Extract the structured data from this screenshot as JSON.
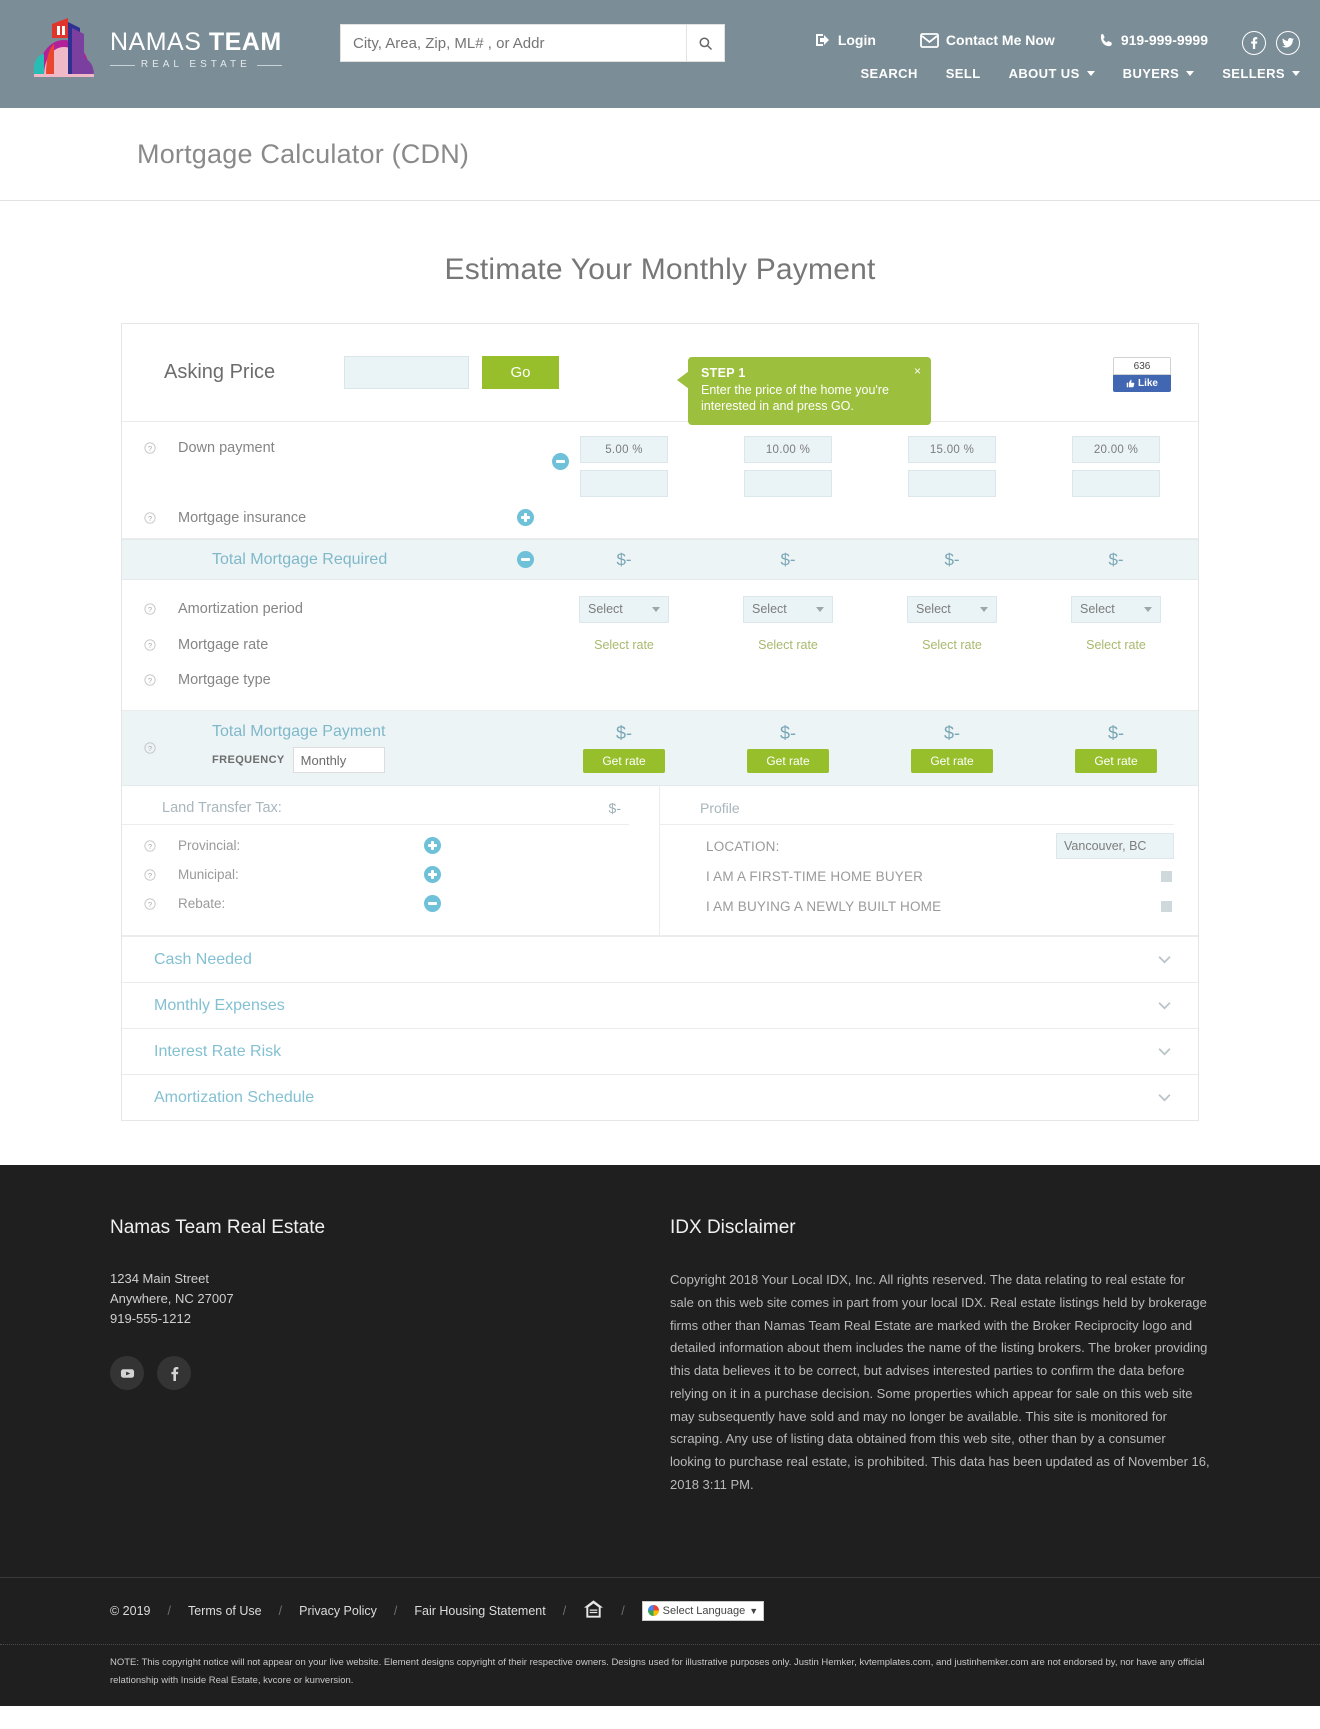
{
  "header": {
    "logo": {
      "line1_light": "NAMAS",
      "line1_bold": "TEAM",
      "line2": "REAL ESTATE"
    },
    "search_placeholder": "City, Area, Zip, ML# , or Addr",
    "search_value": "",
    "login_label": "Login",
    "contact_label": "Contact Me Now",
    "phone": "919-999-9999",
    "nav": [
      {
        "label": "SEARCH",
        "has_caret": false
      },
      {
        "label": "SELL",
        "has_caret": false
      },
      {
        "label": "ABOUT US",
        "has_caret": true
      },
      {
        "label": "BUYERS",
        "has_caret": true
      },
      {
        "label": "SELLERS",
        "has_caret": true
      }
    ]
  },
  "page_title": "Mortgage Calculator (CDN)",
  "calculator": {
    "heading": "Estimate Your Monthly Payment",
    "asking_price_label": "Asking Price",
    "asking_price_value": "",
    "go_label": "Go",
    "tooltip": {
      "step": "STEP 1",
      "body": "Enter the price of the home you're interested in and press GO.",
      "close": "×"
    },
    "facebook": {
      "count": "636",
      "like": "Like"
    },
    "down_payment_label": "Down payment",
    "mortgage_insurance_label": "Mortgage insurance",
    "down_payment_percents": [
      "5.00 %",
      "10.00 %",
      "15.00 %",
      "20.00 %"
    ],
    "down_payment_amounts": [
      "",
      "",
      "",
      ""
    ],
    "total_required_label": "Total Mortgage Required",
    "total_required_values": [
      "$-",
      "$-",
      "$-",
      "$-"
    ],
    "amortization_label": "Amortization period",
    "amortization_values": [
      "Select",
      "Select",
      "Select",
      "Select"
    ],
    "mortgage_rate_label": "Mortgage rate",
    "mortgage_rate_values": [
      "Select rate",
      "Select rate",
      "Select rate",
      "Select rate"
    ],
    "mortgage_type_label": "Mortgage type",
    "total_payment_label": "Total Mortgage Payment",
    "total_payment_values": [
      "$-",
      "$-",
      "$-",
      "$-"
    ],
    "frequency_label": "FREQUENCY",
    "frequency_value": "Monthly",
    "get_rate_label": "Get rate",
    "land_transfer": {
      "title": "Land Transfer Tax:",
      "value": "$-",
      "rows": [
        {
          "label": "Provincial:",
          "ctrl": "plus"
        },
        {
          "label": "Municipal:",
          "ctrl": "plus"
        },
        {
          "label": "Rebate:",
          "ctrl": "minus"
        }
      ]
    },
    "profile": {
      "title": "Profile",
      "location_label": "LOCATION:",
      "location_value": "Vancouver, BC",
      "checks": [
        {
          "label": "I AM A FIRST-TIME HOME BUYER"
        },
        {
          "label": "I AM BUYING A NEWLY BUILT HOME"
        }
      ]
    },
    "accordions": [
      {
        "label": "Cash Needed"
      },
      {
        "label": "Monthly Expenses"
      },
      {
        "label": "Interest Rate Risk"
      },
      {
        "label": "Amortization Schedule"
      }
    ]
  },
  "footer": {
    "company_heading": "Namas Team Real Estate",
    "address_line1": "1234 Main Street",
    "address_line2": "Anywhere, NC 27007",
    "phone": "919-555-1212",
    "idx_heading": "IDX Disclaimer",
    "idx_text": "Copyright 2018 Your Local IDX, Inc. All rights reserved. The data relating to real estate for sale on this web site comes in part from your local IDX. Real estate listings held by brokerage firms other than Namas Team Real Estate are marked with the Broker Reciprocity logo and detailed information about them includes the name of the listing brokers. The broker providing this data believes it to be correct, but advises interested parties to confirm the data before relying on it in a purchase decision. Some properties which appear for sale on this web site may subsequently have sold and may no longer be available. This site is monitored for scraping. Any use of listing data obtained from this web site, other than by a consumer looking to purchase real estate, is prohibited. This data has been updated as of November 16, 2018 3:11 PM.",
    "copyright": "© 2019",
    "links": [
      "Terms of Use",
      "Privacy Policy",
      "Fair Housing Statement"
    ],
    "translate_label": "Select Language",
    "note": "NOTE: This copyright notice will not appear on your live website. Element designs copyright of their respective owners. Designs used for illustrative purposes only. Justin Hemker, kvtemplates.com, and justinhemker.com are not endorsed by, nor have any official relationship with Inside Real Estate, kvcore or kunversion."
  },
  "colors": {
    "header_bg": "#7b8d96",
    "accent_green": "#97bf2b",
    "accent_teal": "#6ec1d8",
    "link_blue": "#83c0d2"
  }
}
